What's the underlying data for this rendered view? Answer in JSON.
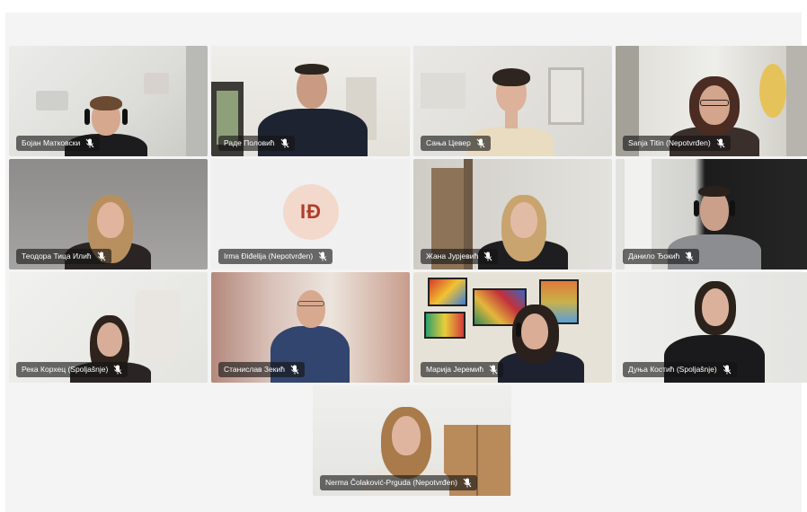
{
  "participants": [
    {
      "name": "Бојан Матковски",
      "muted": true
    },
    {
      "name": "Раде Половић",
      "muted": true
    },
    {
      "name": "Сања Цевер",
      "muted": true
    },
    {
      "name": "Sanja Titin (Nepotvrđen)",
      "muted": true
    },
    {
      "name": "Теодора Тица Илић",
      "muted": true
    },
    {
      "name": "Irma Điđelija (Nepotvrđen)",
      "muted": true,
      "initials": "IĐ",
      "avatar_color": "#f3d8cc",
      "initials_color": "#b13c2a"
    },
    {
      "name": "Жана Јурјевић",
      "muted": true
    },
    {
      "name": "Данило Ђокић",
      "muted": true
    },
    {
      "name": "Река Корхец (Spoljašnje)",
      "muted": true
    },
    {
      "name": "Станислав Зекић",
      "muted": true
    },
    {
      "name": "Марија Јеремић",
      "muted": true
    },
    {
      "name": "Дуња Костић (Spoljašnje)",
      "muted": true
    },
    {
      "name": "Nerma Čolaković-Prguda (Nepotvrđen)",
      "muted": true
    }
  ],
  "icons": {
    "mic_muted": "mic-off-icon"
  }
}
